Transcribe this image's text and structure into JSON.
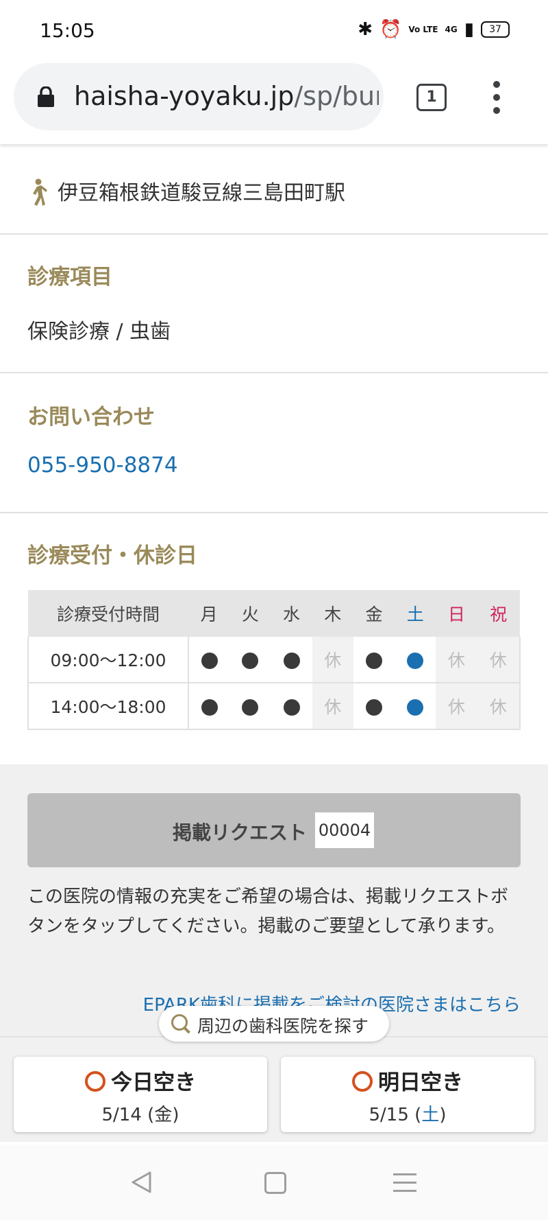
{
  "status": {
    "time": "15:05",
    "network": "4G",
    "lte": "Vo LTE",
    "battery": "37"
  },
  "browser": {
    "url_host": "haisha-yoyaku.jp",
    "url_path": "/sp/bur",
    "tab_count": "1"
  },
  "station": {
    "text": "伊豆箱根鉄道駿豆線三島田町駅",
    "icon": "walk-icon"
  },
  "medical_menu": {
    "title": "診療項目",
    "value": "保険診療 / 虫歯"
  },
  "contact": {
    "title": "お問い合わせ",
    "phone": "055-950-8874"
  },
  "schedule": {
    "title": "診療受付・休診日",
    "header_time": "診療受付時間",
    "days": [
      "月",
      "火",
      "水",
      "木",
      "金",
      "土",
      "日",
      "祝"
    ],
    "closed_label": "休",
    "rows": [
      {
        "time": "09:00〜12:00",
        "slots": [
          "open",
          "open",
          "open",
          "closed",
          "open",
          "open-sat",
          "closed",
          "closed"
        ]
      },
      {
        "time": "14:00〜18:00",
        "slots": [
          "open",
          "open",
          "open",
          "closed",
          "open",
          "open-sat",
          "closed",
          "closed"
        ]
      }
    ],
    "colors": {
      "saturday": "#1a6fb0",
      "sunday_holiday": "#d0245e",
      "open_dot": "#3a3a3a"
    }
  },
  "request": {
    "label": "掲載リクエスト",
    "count": "00004",
    "description": "この医院の情報の充実をご希望の場合は、掲載リクエストボタンをタップしてください。掲載のご要望として承ります。",
    "epark_link": "EPARK歯科に掲載をご検討の医院さまはこちら"
  },
  "search_nearby": {
    "label": "周辺の歯科医院を探す"
  },
  "availability": {
    "today": {
      "title": "今日空き",
      "date": "5/14",
      "dow": "金"
    },
    "tomorrow": {
      "title": "明日空き",
      "date": "5/15",
      "dow": "土"
    }
  },
  "accent_color": "#9a8a5a"
}
